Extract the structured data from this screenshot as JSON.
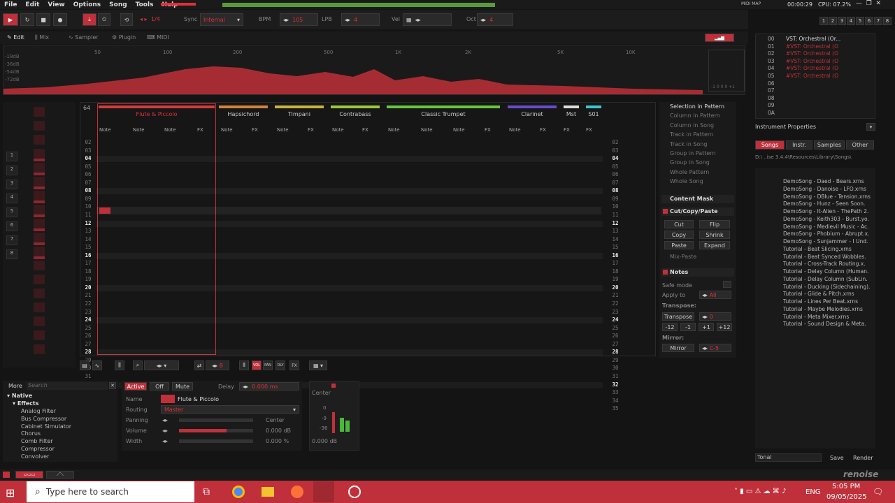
{
  "menu": {
    "file": "File",
    "edit": "Edit",
    "view": "View",
    "options": "Options",
    "song": "Song",
    "tools": "Tools",
    "help": "Help"
  },
  "status": {
    "midi": "MIDI MAP",
    "time": "00:00:29",
    "cpu": "CPU: 07.2%"
  },
  "transport": {
    "pattern_frac": "1/4",
    "sync_label": "Sync",
    "sync_value": "Internal",
    "bpm_label": "BPM",
    "bpm": "105",
    "lpb_label": "LPB",
    "lpb": "4",
    "vel_label": "Vel",
    "oct_label": "Oct",
    "oct": "4"
  },
  "seq_nums": [
    "1",
    "2",
    "3",
    "4",
    "5",
    "6",
    "7",
    "8"
  ],
  "tabs": {
    "edit": "Edit",
    "mix": "Mix",
    "sampler": "Sampler",
    "plugin": "Plugin",
    "midi": "MIDI"
  },
  "spectrum": {
    "freqs": [
      "50",
      "100",
      "200",
      "500",
      "1K",
      "2K",
      "5K",
      "10K"
    ],
    "db": [
      "-18dB",
      "-36dB",
      "-54dB",
      "-72dB"
    ],
    "lr": "-1 0 0 0 +1"
  },
  "instruments": [
    {
      "num": "00",
      "name": "VST: Orchestral (Or..."
    },
    {
      "num": "01",
      "name": "#VST: Orchestral (O"
    },
    {
      "num": "02",
      "name": "#VST: Orchestral (O"
    },
    {
      "num": "03",
      "name": "#VST: Orchestral (O"
    },
    {
      "num": "04",
      "name": "#VST: Orchestral (O"
    },
    {
      "num": "05",
      "name": "#VST: Orchestral (O"
    },
    {
      "num": "06",
      "name": ""
    },
    {
      "num": "07",
      "name": ""
    },
    {
      "num": "08",
      "name": ""
    },
    {
      "num": "09",
      "name": ""
    },
    {
      "num": "0A",
      "name": ""
    }
  ],
  "instr_props": "Instrument Properties",
  "browser_tabs": {
    "songs": "Songs",
    "instr": "Instr.",
    "samples": "Samples",
    "other": "Other"
  },
  "browser_path": "D:\\ ..ise 3.4.4\\Resources\\Library\\Songs\\",
  "songs": [
    "DemoSong - Daed - Bears.xrns",
    "DemoSong - Danoise - LFO.xrns",
    "DemoSong - DBlue - Tension.xrns",
    "DemoSong - Hunz - Seen Soon.",
    "DemoSong - It-Alien - ThePath 2.",
    "DemoSong - Keith303 - Burst.yo.",
    "DemoSong - Medievil Music - Ac.",
    "DemoSong - Phobium - Abrupt.x.",
    "DemoSong - Sunjammer - I Und.",
    "Tutorial - Beat Slicing.xrns",
    "Tutorial - Beat Synced Wobbles.",
    "Tutorial - Cross-Track Routing.x.",
    "Tutorial - Delay Column (Human.",
    "Tutorial - Delay Column (SubLin.",
    "Tutorial - Ducking (Sidechaining).",
    "Tutorial - Glide & Pitch.xrns",
    "Tutorial - Lines Per Beat.xrns",
    "Tutorial - Maybe Melodies.xrns",
    "Tutorial - Meta Mixer.xrns",
    "Tutorial - Sound Design & Meta."
  ],
  "browser_bottom": {
    "input": "Tonal",
    "save": "Save",
    "render": "Render"
  },
  "pattern": {
    "lines": "64",
    "tracks": [
      "Flute & Piccolo",
      "Hapsichord",
      "Timpani",
      "Contrabass",
      "Classic Trumpet",
      "Clarinet",
      "Mst",
      "S01"
    ],
    "note": "Note",
    "fx": "FX",
    "play": "PLAY"
  },
  "rows_left": [
    {
      "n": "02",
      "y": 0
    },
    {
      "n": "03",
      "y": 1
    },
    {
      "n": "04",
      "y": 2
    },
    {
      "n": "05",
      "y": 3
    },
    {
      "n": "06",
      "y": 4
    },
    {
      "n": "07",
      "y": 5
    },
    {
      "n": "08",
      "y": 6
    },
    {
      "n": "09",
      "y": 7
    },
    {
      "n": "10",
      "y": 8
    },
    {
      "n": "11",
      "y": 9
    },
    {
      "n": "12",
      "y": 10
    },
    {
      "n": "13",
      "y": 11
    },
    {
      "n": "14",
      "y": 12
    },
    {
      "n": "15",
      "y": 13
    },
    {
      "n": "16",
      "y": 14
    },
    {
      "n": "17",
      "y": 15
    },
    {
      "n": "18",
      "y": 16
    },
    {
      "n": "19",
      "y": 17
    },
    {
      "n": "20",
      "y": 18
    },
    {
      "n": "21",
      "y": 19
    },
    {
      "n": "22",
      "y": 20
    },
    {
      "n": "23",
      "y": 21
    },
    {
      "n": "24",
      "y": 22
    },
    {
      "n": "25",
      "y": 23
    },
    {
      "n": "26",
      "y": 24
    },
    {
      "n": "27",
      "y": 25
    },
    {
      "n": "28",
      "y": 26
    },
    {
      "n": "29",
      "y": 27
    },
    {
      "n": "30",
      "y": 28
    },
    {
      "n": "31",
      "y": 29
    },
    {
      "n": "32",
      "y": 30
    },
    {
      "n": "33",
      "y": 31
    },
    {
      "n": "34",
      "y": 32
    },
    {
      "n": "35",
      "y": 33
    }
  ],
  "selection_options": [
    "Selection in Pattern",
    "Column in Pattern",
    "Column in Song",
    "Track in Pattern",
    "Track in Song",
    "Group in Pattern",
    "Group in Song",
    "Whole Pattern",
    "Whole Song"
  ],
  "content_mask": "Content Mask",
  "ccp": {
    "title": "Cut/Copy/Paste",
    "cut": "Cut",
    "flip": "Flip",
    "copy": "Copy",
    "shrink": "Shrink",
    "paste": "Paste",
    "expand": "Expand",
    "mixpaste": "Mix-Paste"
  },
  "notes": {
    "title": "Notes",
    "safe": "Safe mode",
    "apply": "Apply to",
    "apply_val": "All",
    "transpose_lbl": "Transpose:",
    "transpose": "Transpose",
    "transpose_val": "0",
    "m12": "-12",
    "m1": "-1",
    "p1": "+1",
    "p12": "+12",
    "mirror_lbl": "Mirror:",
    "mirror": "Mirror",
    "mirror_val": "C-5"
  },
  "pattern_toolbar": {
    "step": "8"
  },
  "dsp": {
    "more": "More",
    "search": "Search",
    "native": "Native",
    "effects": "Effects",
    "items": [
      "Analog Filter",
      "Bus Compressor",
      "Cabinet Simulator",
      "Chorus",
      "Comb Filter",
      "Compressor",
      "Convolver"
    ]
  },
  "track_dsp": {
    "active": "Active",
    "off": "Off",
    "mute": "Mute",
    "delay": "Delay",
    "delay_val": "0.000 ms",
    "name_lbl": "Name",
    "name": "Flute & Piccolo",
    "routing_lbl": "Routing",
    "routing": "Master",
    "panning_lbl": "Panning",
    "panning": "Center",
    "volume_lbl": "Volume",
    "volume": "0.000 dB",
    "width_lbl": "Width",
    "width": "0.000 %"
  },
  "meter": {
    "center": "Center",
    "db0": "0",
    "db9": "-9",
    "db36": "-36",
    "val": "0.000 dB"
  },
  "taskbar": {
    "search": "Type here to search",
    "lang": "ENG",
    "time": "5:05 PM",
    "date": "09/05/2025"
  },
  "brand": "renoise",
  "colors": {
    "accent": "#e0303a",
    "flute": "#d63a3a",
    "hapsichord": "#d4843a",
    "timpani": "#c8b43a",
    "contrabass": "#9ac83a",
    "trumpet": "#64c83a",
    "clarinet": "#6a4ad0",
    "mst": "#dddddd",
    "s01": "#3ac8c8"
  }
}
